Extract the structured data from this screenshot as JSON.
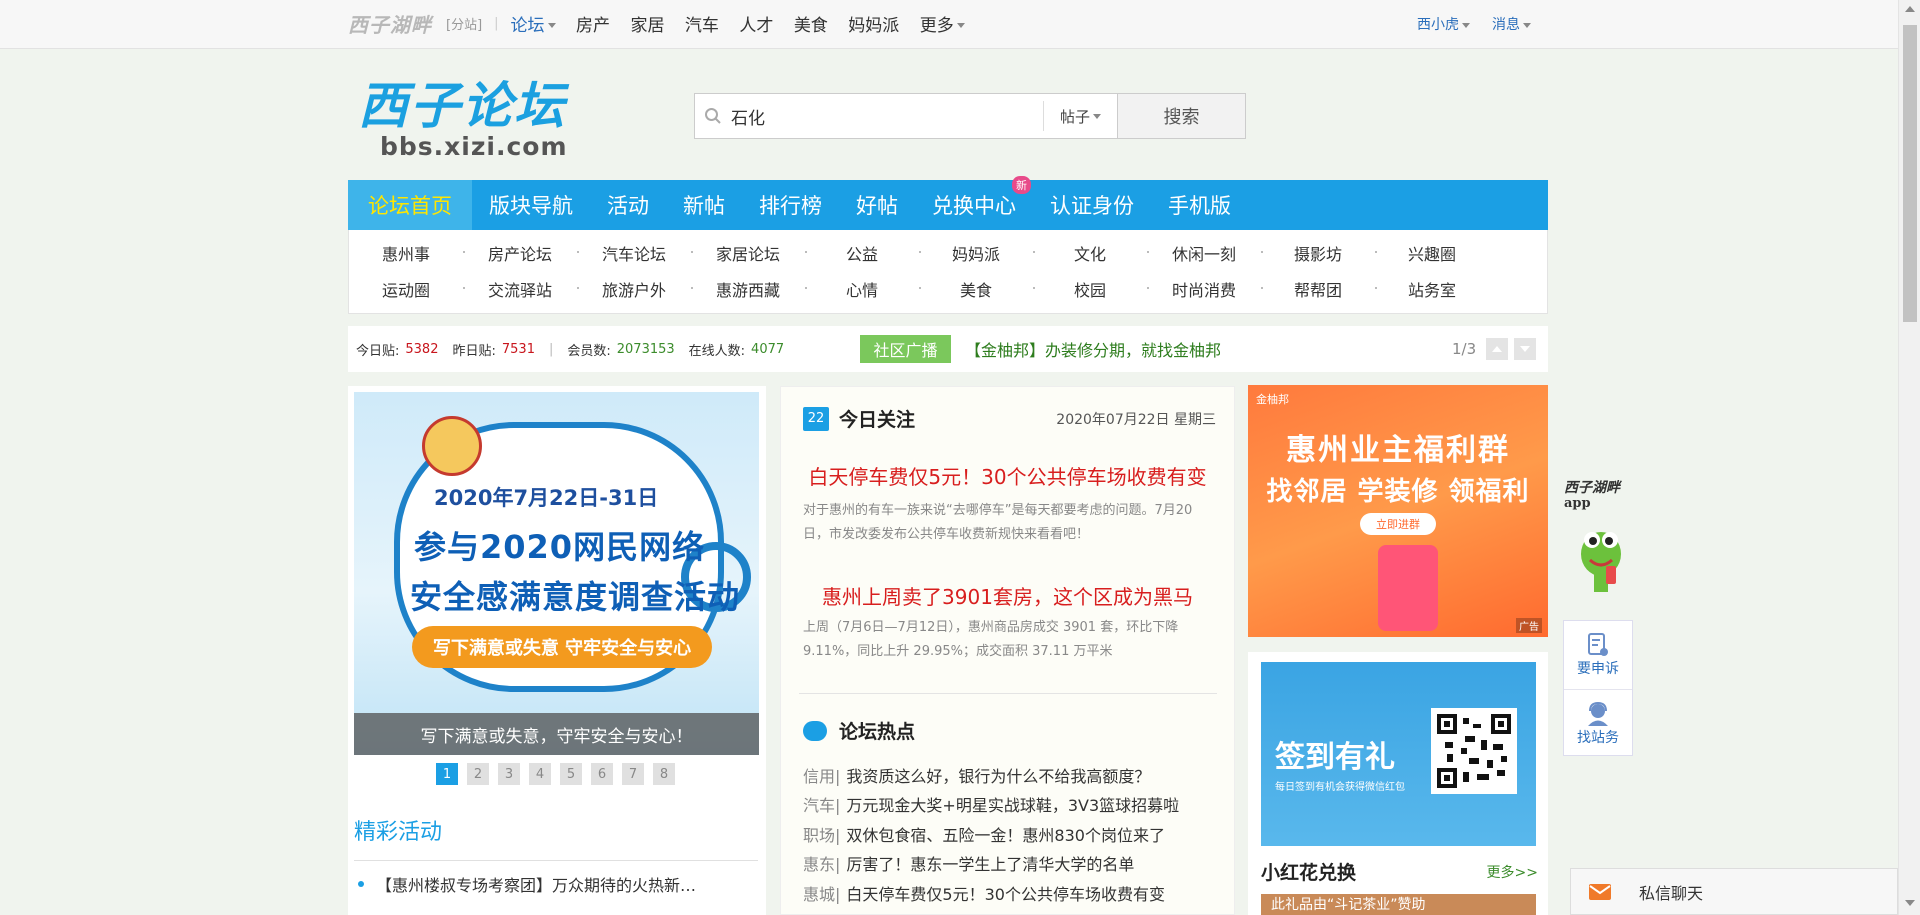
{
  "topbar": {
    "logo": "西子湖畔",
    "fenzhan": "[分站]",
    "nav": [
      {
        "label": "论坛",
        "dropdown": true
      },
      {
        "label": "房产"
      },
      {
        "label": "家居"
      },
      {
        "label": "汽车"
      },
      {
        "label": "人才"
      },
      {
        "label": "美食"
      },
      {
        "label": "妈妈派"
      },
      {
        "label": "更多",
        "dropdown": true
      }
    ],
    "user": "西小虎",
    "messages": "消息"
  },
  "header": {
    "logo_cn": "西子论坛",
    "logo_url": "bbs.xizi.com"
  },
  "search": {
    "value": "石化",
    "type": "帖子",
    "button": "搜索"
  },
  "mainnav": {
    "items": [
      "论坛首页",
      "版块导航",
      "活动",
      "新帖",
      "排行榜",
      "好帖",
      "兑换中心",
      "认证身份",
      "手机版"
    ],
    "new_badge": "新"
  },
  "subnav": {
    "row1": [
      "惠州事",
      "房产论坛",
      "汽车论坛",
      "家居论坛",
      "公益",
      "妈妈派",
      "文化",
      "休闲一刻",
      "摄影坊",
      "兴趣圈"
    ],
    "row2": [
      "运动圈",
      "交流驿站",
      "旅游户外",
      "惠游西藏",
      "心情",
      "美食",
      "校园",
      "时尚消费",
      "帮帮团",
      "站务室"
    ]
  },
  "stats": {
    "today_label": "今日贴:",
    "today": "5382",
    "yesterday_label": "昨日贴:",
    "yesterday": "7531",
    "members_label": "会员数:",
    "members": "2073153",
    "online_label": "在线人数:",
    "online": "4077"
  },
  "broadcast": {
    "tag": "社区广播",
    "text": "【金柚邦】办装修分期，就找金柚邦",
    "page": "1/3"
  },
  "left": {
    "banner": {
      "date": "2020年7月22日-31日",
      "line1": "参与2020网民网络",
      "line2": "安全感满意度调查活动",
      "pill": "写下满意或失意  守牢安全与安心",
      "caption": "写下满意或失意，守牢安全与安心！"
    },
    "pages": [
      "1",
      "2",
      "3",
      "4",
      "5",
      "6",
      "7",
      "8"
    ],
    "section_title": "精彩活动",
    "activity": "【惠州楼叔专场考察团】万众期待的火热新…"
  },
  "mid": {
    "cal_day": "22",
    "title": "今日关注",
    "date": "2020年07月22日 星期三",
    "headline1": "白天停车费仅5元！30个公共停车场收费有变",
    "summary1": "对于惠州的有车一族来说“去哪停车”是每天都要考虑的问题。7月20日，市发改委发布公共停车收费新规快来看看吧！",
    "headline2": "惠州上周卖了3901套房，这个区成为黑马",
    "summary2": "上周（7月6日—7月12日），惠州商品房成交 3901 套，环比下降9.11%，同比上升 29.95%；成交面积 37.11 万平米",
    "hot_title": "论坛热点",
    "hot": [
      {
        "cat": "信用|",
        "text": "我资质这么好，银行为什么不给我高额度？"
      },
      {
        "cat": "汽车|",
        "text": "万元现金大奖+明星实战球鞋，3V3篮球招募啦"
      },
      {
        "cat": "职场|",
        "text": "双休包食宿、五险一金！惠州830个岗位来了"
      },
      {
        "cat": "惠东|",
        "text": "厉害了！惠东一学生上了清华大学的名单"
      },
      {
        "cat": "惠城|",
        "text": "白天停车费仅5元！30个公共停车场收费有变"
      }
    ]
  },
  "right": {
    "ad": {
      "brand": "金柚邦",
      "line1": "惠州业主福利群",
      "line2": "找邻居 学装修 领福利",
      "button": "立即进群",
      "tag": "广告"
    },
    "qr": {
      "title": "签到有礼",
      "sub": "每日签到有机会获得微信红包"
    },
    "section": "小红花兑换",
    "more": "更多>>",
    "strip": "此礼品由“斗记茶业”赞助"
  },
  "sidefloat": {
    "logo1": "西子湖畔",
    "logo2": "app",
    "btn1": "要申诉",
    "btn2": "找站务"
  },
  "chat": {
    "label": "私信聊天"
  },
  "colors": {
    "brand_blue": "#1b9fe4",
    "nav_active_text": "#ffe600",
    "stat_red": "#c8161d",
    "stat_green": "#3c8c2c",
    "headline_red": "#d81e1e"
  }
}
